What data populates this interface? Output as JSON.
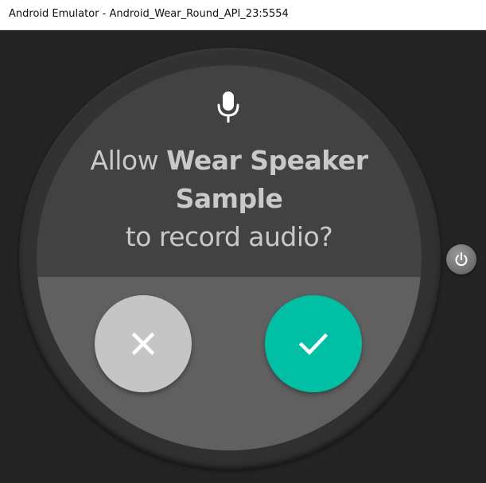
{
  "window": {
    "title": "Android Emulator - Android_Wear_Round_API_23:5554"
  },
  "dialog": {
    "icon": "microphone-icon",
    "prompt_prefix": "Allow",
    "app_name": "Wear Speaker Sample",
    "prompt_suffix": "to record audio?",
    "deny_icon": "close-icon",
    "allow_icon": "check-icon"
  },
  "device": {
    "power_icon": "power-icon"
  },
  "colors": {
    "window_bg": "#242424",
    "bezel": "#333333",
    "screen_upper": "#424242",
    "screen_lower": "#606060",
    "prompt_text": "#c9c9c9",
    "deny_button": "#c5c5c5",
    "allow_button": "#00bfa5",
    "icon_white": "#ffffff"
  }
}
